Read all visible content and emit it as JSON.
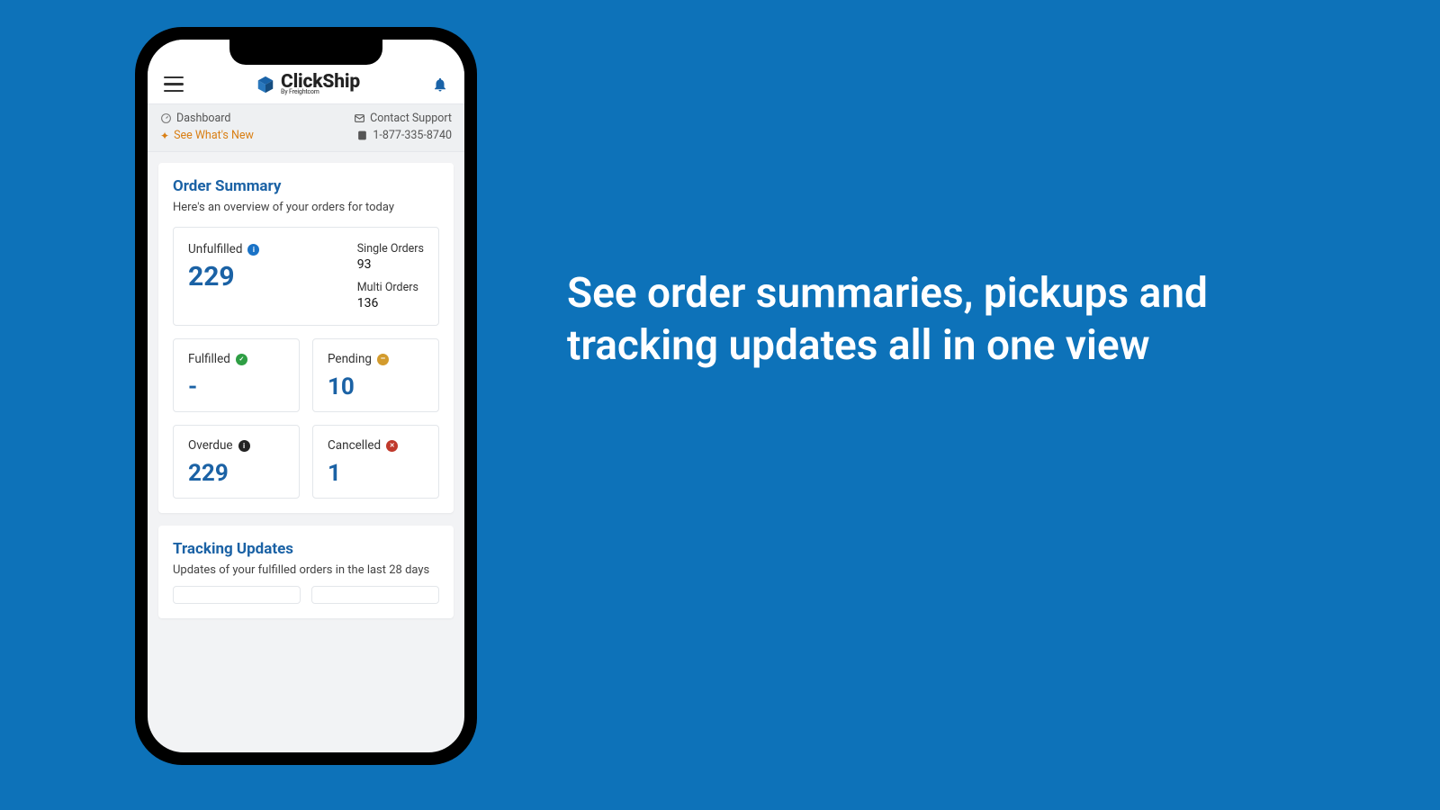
{
  "marketing": {
    "headline": "See order summaries, pickups and tracking updates all in one view"
  },
  "brand": {
    "name": "ClickShip",
    "byline": "By Freightcom"
  },
  "subheader": {
    "dashboard": "Dashboard",
    "whats_new": "See What's New",
    "contact": "Contact Support",
    "phone": "1-877-335-8740"
  },
  "orderSummary": {
    "title": "Order Summary",
    "subtitle": "Here's an overview of your orders for today",
    "unfulfilled": {
      "label": "Unfulfilled",
      "value": "229"
    },
    "single": {
      "label": "Single Orders",
      "value": "93"
    },
    "multi": {
      "label": "Multi Orders",
      "value": "136"
    },
    "fulfilled": {
      "label": "Fulfilled",
      "value": "-"
    },
    "pending": {
      "label": "Pending",
      "value": "10"
    },
    "overdue": {
      "label": "Overdue",
      "value": "229"
    },
    "cancelled": {
      "label": "Cancelled",
      "value": "1"
    }
  },
  "tracking": {
    "title": "Tracking Updates",
    "subtitle": "Updates of your fulfilled orders in the last 28 days"
  }
}
